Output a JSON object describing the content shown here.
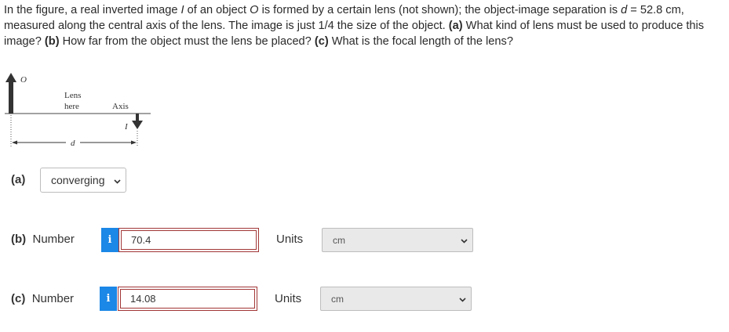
{
  "question": {
    "t1": "In the figure, a real inverted image ",
    "t2": "I",
    "t3": " of an object ",
    "t4": "O",
    "t5": " is formed by a certain lens (not shown); the object-image separation is ",
    "t6": "d",
    "t7": " = 52.8 cm, measured along the central axis of the lens. The image is just 1/4 the size of the object. ",
    "t8": "(a)",
    "t9": " What kind of lens must be used to produce this image? ",
    "t10": "(b)",
    "t11": " How far from the object must the lens be placed? ",
    "t12": "(c)",
    "t13": " What is the focal length of the lens?"
  },
  "figure": {
    "object_label": "O",
    "lens_label_line1": "Lens",
    "lens_label_line2": "here",
    "axis_label": "Axis",
    "image_label": "I",
    "distance_label": "d"
  },
  "part_a": {
    "label": "(a)",
    "selected": "converging",
    "icon": "chevron-down-icon"
  },
  "part_b": {
    "label": "(b)",
    "field_label": "Number",
    "info_icon": "i",
    "value": "70.4",
    "units_label": "Units",
    "units_value": "cm"
  },
  "part_c": {
    "label": "(c)",
    "field_label": "Number",
    "info_icon": "i",
    "value": "14.08",
    "units_label": "Units",
    "units_value": "cm"
  },
  "colors": {
    "info_button": "#1b87e6",
    "answer_border": "#a23636",
    "units_background": "#e9e9e9"
  }
}
